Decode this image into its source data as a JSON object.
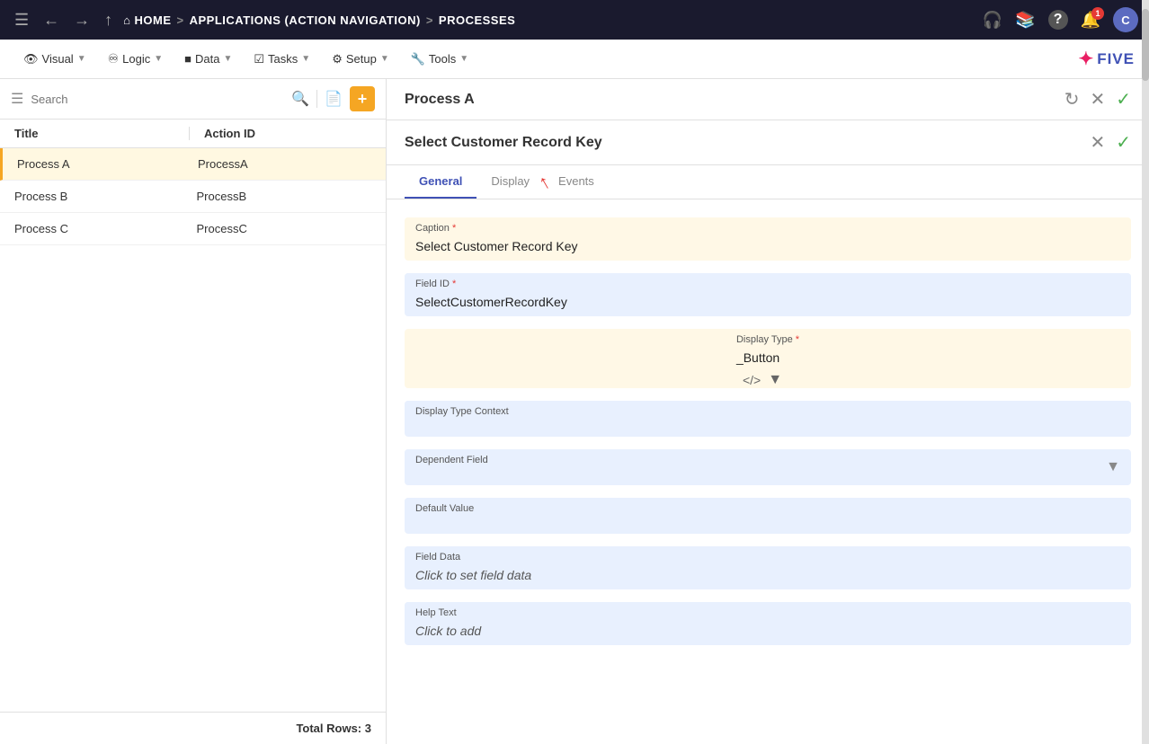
{
  "topNav": {
    "hamburger": "☰",
    "back": "←",
    "forward": "→",
    "up": "↑",
    "home": "⌂",
    "homeLabel": "HOME",
    "sep1": ">",
    "crumb1": "APPLICATIONS (ACTION NAVIGATION)",
    "sep2": ">",
    "crumb2": "PROCESSES",
    "rightIcons": {
      "headset": "🎧",
      "books": "📚",
      "help": "?",
      "notifCount": "1",
      "avatarLabel": "C"
    }
  },
  "secondNav": {
    "items": [
      {
        "label": "Visual",
        "icon": "👁"
      },
      {
        "label": "Logic",
        "icon": "⟳"
      },
      {
        "label": "Data",
        "icon": "▦"
      },
      {
        "label": "Tasks",
        "icon": "☑"
      },
      {
        "label": "Setup",
        "icon": "⚙"
      },
      {
        "label": "Tools",
        "icon": "🔧"
      }
    ],
    "logoText": "FIVE"
  },
  "leftPanel": {
    "searchPlaceholder": "Search",
    "tableHeaders": {
      "title": "Title",
      "actionId": "Action ID"
    },
    "rows": [
      {
        "title": "Process A",
        "actionId": "ProcessA",
        "active": true
      },
      {
        "title": "Process B",
        "actionId": "ProcessB",
        "active": false
      },
      {
        "title": "Process C",
        "actionId": "ProcessC",
        "active": false
      }
    ],
    "footerLabel": "Total Rows:",
    "footerCount": "3"
  },
  "rightHeader": {
    "title": "Process A"
  },
  "formPanel": {
    "title": "Select Customer Record Key",
    "tabs": [
      {
        "label": "General",
        "active": true
      },
      {
        "label": "Display",
        "active": false
      },
      {
        "label": "Events",
        "active": false
      }
    ],
    "fields": {
      "caption": {
        "label": "Caption",
        "required": true,
        "value": "Select Customer Record Key"
      },
      "fieldId": {
        "label": "Field ID",
        "required": true,
        "value": "SelectCustomerRecordKey"
      },
      "displayType": {
        "label": "Display Type",
        "required": true,
        "value": "_Button"
      },
      "displayTypeContext": {
        "label": "Display Type Context",
        "value": ""
      },
      "dependentField": {
        "label": "Dependent Field",
        "value": ""
      },
      "defaultValue": {
        "label": "Default Value",
        "value": ""
      },
      "fieldData": {
        "label": "Field Data",
        "value": "Click to set field data"
      },
      "helpText": {
        "label": "Help Text",
        "value": "Click to add"
      }
    }
  }
}
